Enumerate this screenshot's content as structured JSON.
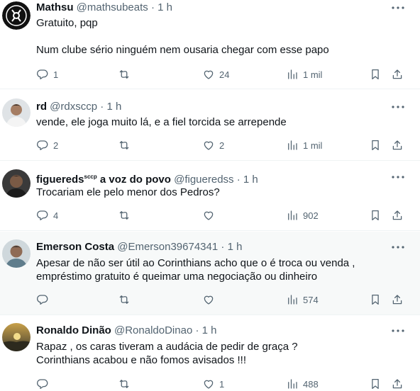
{
  "tweets": [
    {
      "name": "Mathsu",
      "name_suffix": "",
      "handle": "@mathsubeats",
      "dot": "·",
      "time": "1 h",
      "text": "Gratuito,  pqp\n\nNum clube sério ninguém nem ousaria  chegar com esse papo",
      "replies": "1",
      "retweets": "",
      "likes": "24",
      "views": "1 mil",
      "avatar_style": "corinthians-logo"
    },
    {
      "name": "rd",
      "name_suffix": "",
      "handle": "@rdxsccp",
      "dot": "·",
      "time": "1 h",
      "text": "vende, ele joga muito lá, e a fiel torcida se arrepende",
      "replies": "2",
      "retweets": "",
      "likes": "2",
      "views": "1 mil",
      "avatar_style": "person-photo"
    },
    {
      "name": "figuereds",
      "name_suffix": "sccp",
      "name_tail": " a voz do povo",
      "handle": "@figueredss",
      "dot": "·",
      "time": "1 h",
      "text": "Trocariam ele pelo menor dos Pedros?",
      "replies": "4",
      "retweets": "",
      "likes": "",
      "views": "902",
      "avatar_style": "person-photo-dark"
    },
    {
      "name": "Emerson Costa",
      "name_suffix": "",
      "handle": "@Emerson39674341",
      "dot": "·",
      "time": "1 h",
      "text": "Apesar de não ser útil ao Corinthians acho que o é troca ou venda ,\nempréstimo gratuito é queimar uma negociação ou dinheiro",
      "replies": "",
      "retweets": "",
      "likes": "",
      "views": "574",
      "avatar_style": "person-photo-light"
    },
    {
      "name": "Ronaldo Dinão",
      "name_suffix": "",
      "handle": "@RonaldoDinao",
      "dot": "·",
      "time": "1 h",
      "text": "Rapaz , os caras tiveram a audácia de pedir de graça ?\nCorinthians acabou e não fomos avisados !!!",
      "replies": "",
      "retweets": "",
      "likes": "1",
      "views": "488",
      "avatar_style": "sunset-photo"
    }
  ],
  "icons": {
    "reply": "reply-icon",
    "retweet": "retweet-icon",
    "like": "heart-icon",
    "views": "views-icon",
    "bookmark": "bookmark-icon",
    "share": "share-icon",
    "more": "more-icon"
  },
  "colors": {
    "text": "#0f1419",
    "secondary": "#536471",
    "divider": "#eff3f4",
    "highlight_bg": "#f7f9f9"
  }
}
